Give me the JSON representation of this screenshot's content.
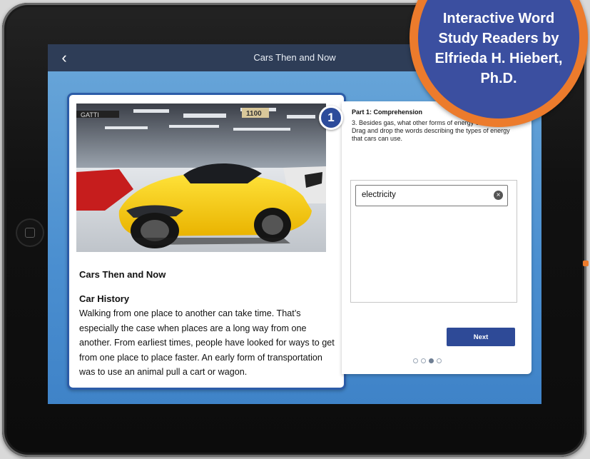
{
  "app": {
    "title": "Cars Then and Now"
  },
  "topbar": {
    "back_icon": "chevron-left-icon",
    "back_glyph": "‹"
  },
  "reader": {
    "story_title": "Cars Then and Now",
    "section_title": "Car History",
    "body": "Walking from one place to another can take time. That’s especially the case when places are a long way from one another. From earliest times, people have looked for ways to get from one place to place faster. An early form of transportation was to use an animal pull a cart or wagon.",
    "photo_sign": "1100",
    "photo_brand": "GATTI"
  },
  "question": {
    "part_title": "Part 1: Comprehension",
    "text": "3. Besides gas, what other forms of energy can cars use? Drag and drop the words describing the types of energy that cars can use.",
    "answers": [
      {
        "label": "electricity",
        "remove_icon": "close-circle-icon"
      }
    ],
    "next_label": "Next",
    "pager": {
      "total": 4,
      "active_index": 2
    }
  },
  "callout": {
    "number": "1"
  },
  "promo": {
    "lines": [
      "Interactive Word",
      "Study Readers by",
      "Elfrieda H. Hiebert,",
      "Ph.D."
    ]
  },
  "colors": {
    "navy": "#2e3d57",
    "accent_blue": "#2e4a97",
    "badge_orange": "#ec7b2c",
    "badge_blue": "#3b4fa0"
  }
}
